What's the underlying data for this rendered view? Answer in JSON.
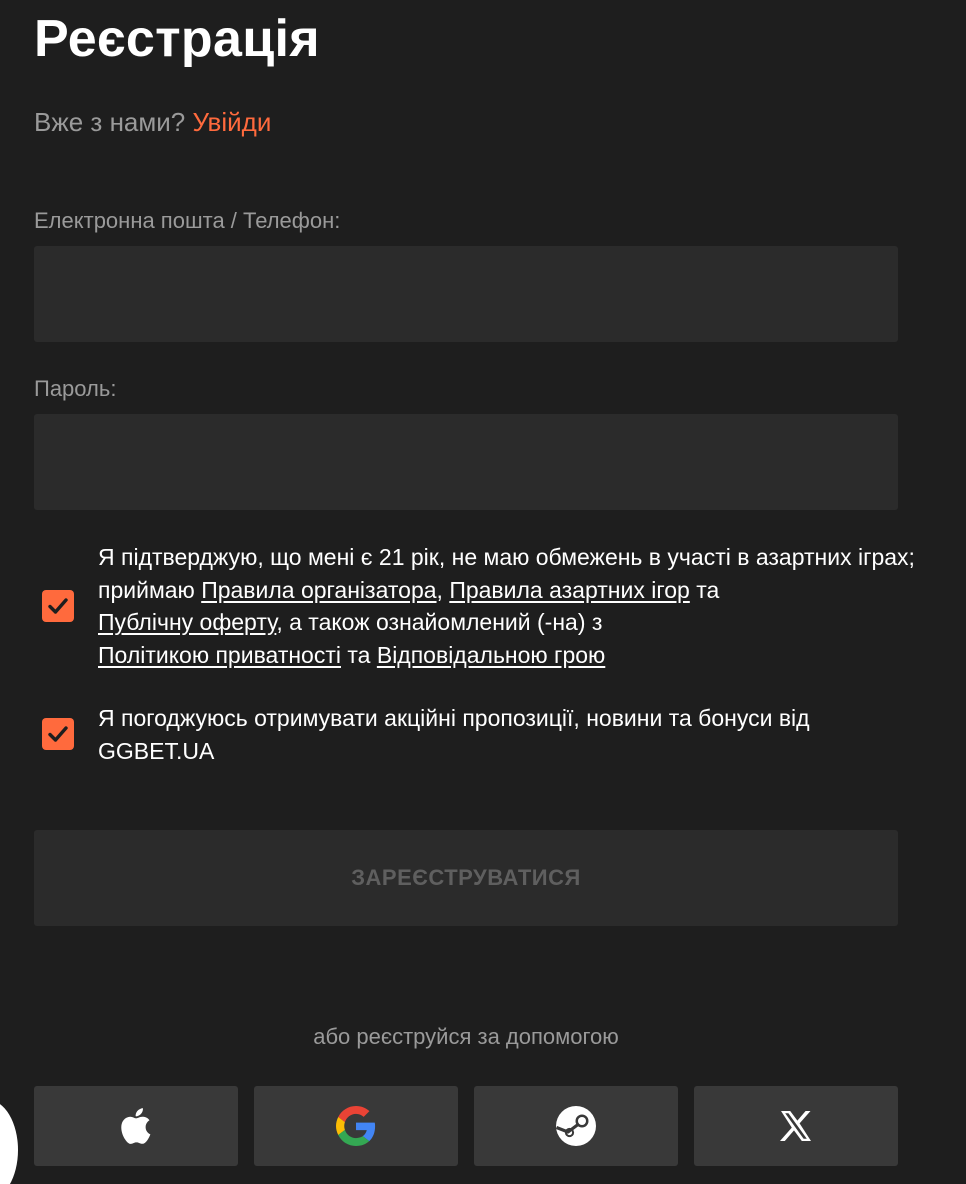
{
  "header": {
    "title": "Реєстрація"
  },
  "login_prompt": {
    "text": "Вже з нами?",
    "link": "Увійди"
  },
  "form": {
    "email_label": "Електронна пошта / Телефон:",
    "email_value": "",
    "password_label": "Пароль:",
    "password_value": ""
  },
  "consents": {
    "terms": {
      "checked": true,
      "text_1": "Я підтверджую, що мені є 21 рік, не маю обмежень в участі в азартних іграх; приймаю ",
      "link_organizer_rules": "Правила організатора",
      "text_2": ", ",
      "link_gambling_rules": "Правила азартних ігор",
      "text_3": " та ",
      "link_public_offer": "Публічну оферту",
      "text_4": ", а також ознайомлений (-на) з ",
      "link_privacy_policy": "Політикою приватності",
      "text_5": " та ",
      "link_responsible_gaming": "Відповідальною грою"
    },
    "promo": {
      "checked": true,
      "text": "Я погоджуюсь отримувати акційні пропозиції, новини та бонуси від GGBET.UA"
    }
  },
  "submit": {
    "label": "ЗАРЕЄСТРУВАТИСЯ",
    "enabled": false
  },
  "social": {
    "text": "або реєструйся за допомогою",
    "providers": [
      "apple-icon",
      "google-icon",
      "steam-icon",
      "x-icon"
    ]
  },
  "colors": {
    "background": "#1e1e1e",
    "input_background": "#2b2b2b",
    "social_button_background": "#393939",
    "accent": "#ff6a3d",
    "muted_text": "#9a9a9a",
    "disabled_text": "#5f5f5f"
  }
}
